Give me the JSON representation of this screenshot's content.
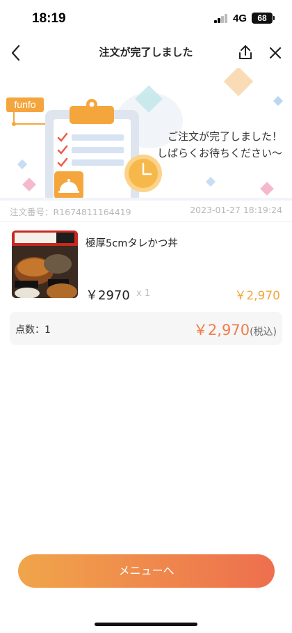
{
  "status_bar": {
    "time": "18:19",
    "network": "4G",
    "battery": "68"
  },
  "nav": {
    "title": "注文が完了しました"
  },
  "banner": {
    "brand": "funfo",
    "message_line1": "ご注文が完了しました！",
    "message_line2": "しばらくお待ちください〜"
  },
  "order": {
    "number": "注文番号：R1674811164419",
    "datetime": "2023-01-27 18:19:24"
  },
  "item": {
    "name": "極厚5cmタレかつ丼",
    "price": "￥2970",
    "qty": "x 1",
    "total": "￥2,970"
  },
  "summary": {
    "count": "点数：1",
    "total": "￥2,970",
    "tax": "(税込)"
  },
  "actions": {
    "menu_button": "メニューへ"
  },
  "colors": {
    "accent_orange": "#f4a63d",
    "total_red": "#ef7d4a",
    "button_start": "#f0a54a",
    "button_end": "#ee6f4e"
  }
}
